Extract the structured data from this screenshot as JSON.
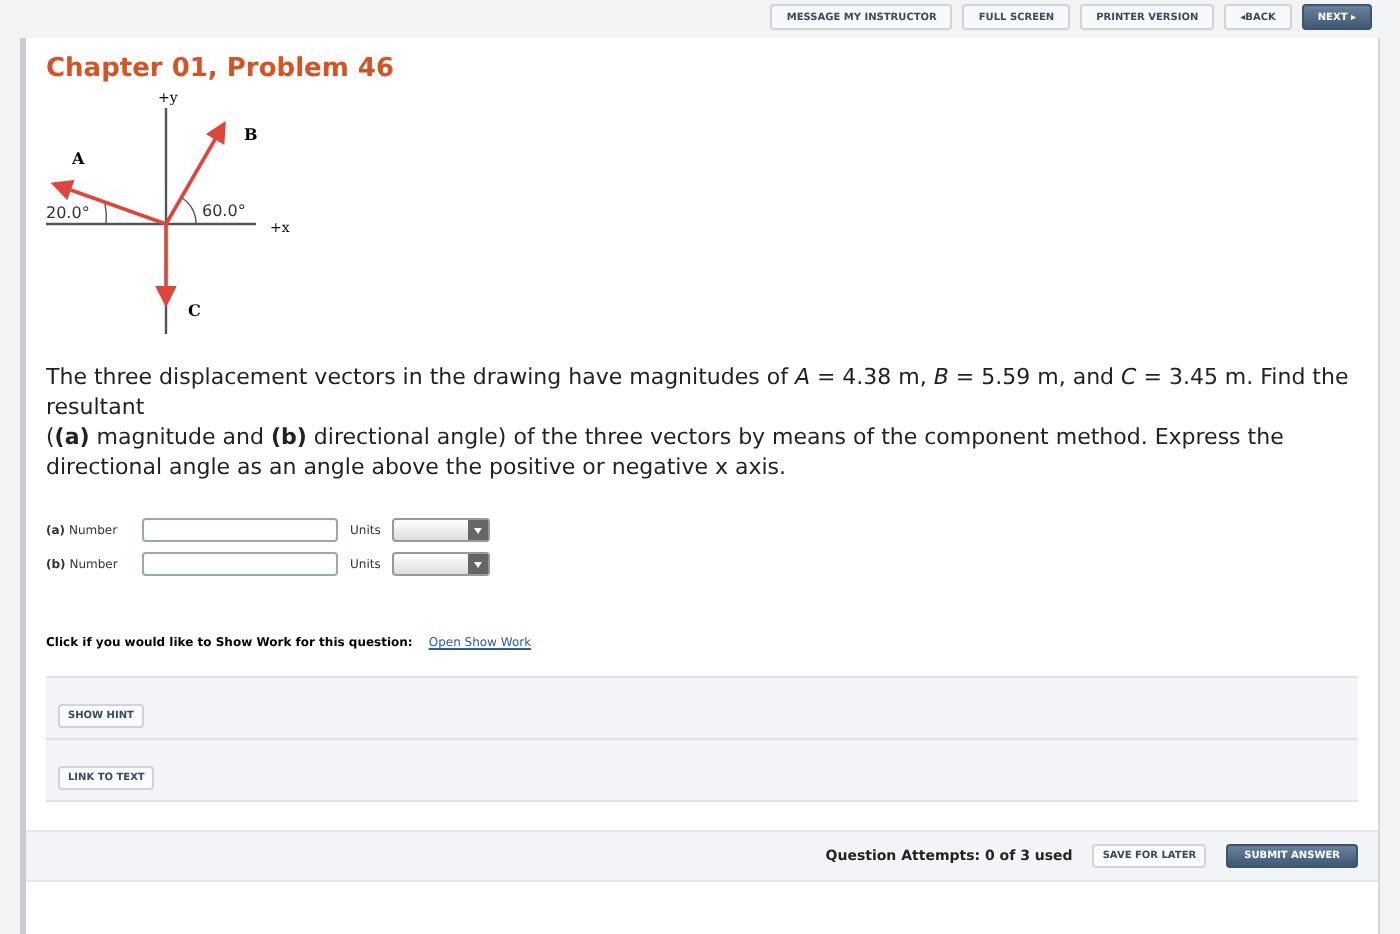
{
  "top_buttons": [
    {
      "label": "MESSAGE MY INSTRUCTOR",
      "kind": "plain"
    },
    {
      "label": "FULL SCREEN",
      "kind": "plain"
    },
    {
      "label": "PRINTER VERSION",
      "kind": "plain"
    },
    {
      "label": "◂BACK",
      "kind": "plain"
    },
    {
      "label": "NEXT ▸",
      "kind": "primary"
    }
  ],
  "title": "Chapter 01, Problem 46",
  "figure": {
    "y_axis": "+y",
    "x_axis": "+x",
    "vector_a": "A",
    "vector_b": "B",
    "vector_c": "C",
    "angle_a": "20.0°",
    "angle_b": "60.0°"
  },
  "problem": [
    "The three displacement vectors in the drawing have magnitudes of *A* = 4.38 m, *B* = 5.59 m, and *C* = 3.45 m. Find the resultant",
    "(**(a)** magnitude and **(b)** directional angle) of the three vectors by means of the component method. Express the directional angle as an angle above the positive or negative x axis."
  ],
  "answers": [
    {
      "part": "(a)",
      "label": "Number",
      "units_label": "Units"
    },
    {
      "part": "(b)",
      "label": "Number",
      "units_label": "Units"
    }
  ],
  "show_work": {
    "prompt": "Click if you would like to Show Work for this question:",
    "link": "Open Show Work"
  },
  "hint_buttons": [
    "SHOW HINT",
    "LINK TO TEXT"
  ],
  "footer": {
    "attempts": "Question Attempts: 0 of 3 used",
    "save": "SAVE FOR LATER",
    "submit": "SUBMIT ANSWER"
  }
}
